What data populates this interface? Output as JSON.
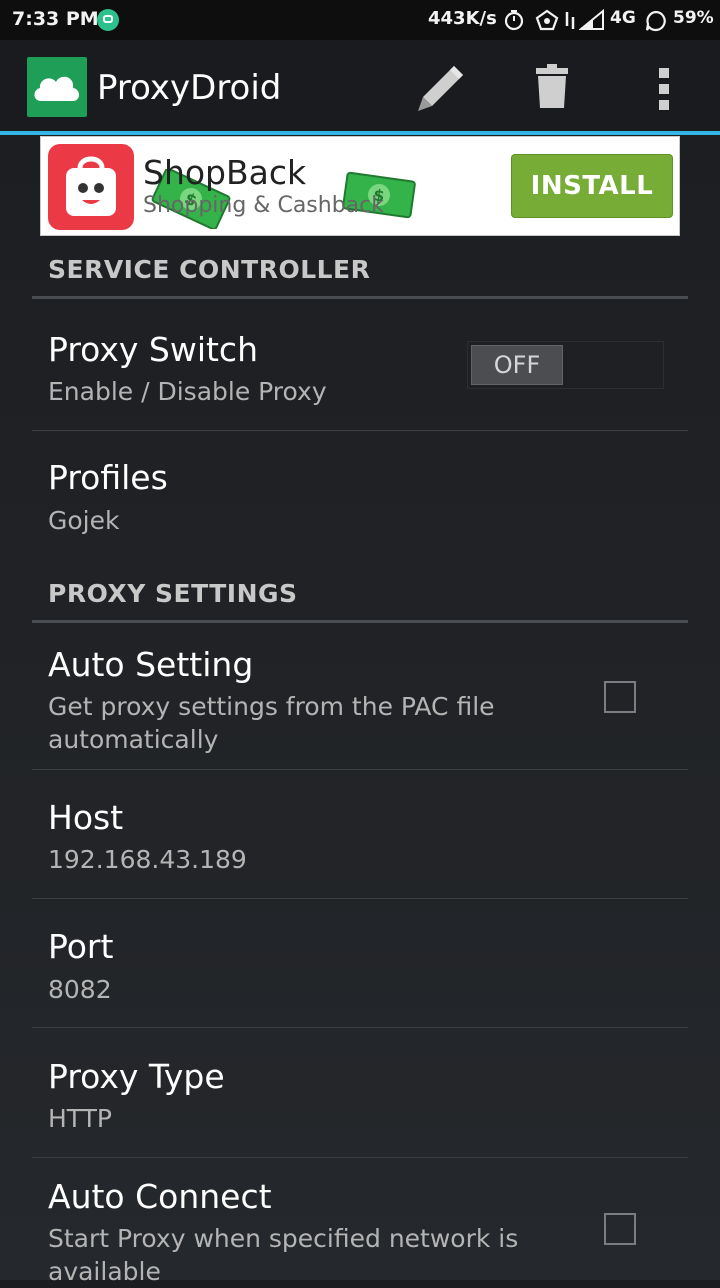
{
  "status_bar": {
    "time": "7:33 PM",
    "speed": "443K/s",
    "network": "4G",
    "battery": "59%",
    "icons": [
      "notification-icon",
      "timer-icon",
      "home-alert-icon",
      "signal-arrows-icon",
      "cell-signal-icon",
      "chat-icon"
    ]
  },
  "action_bar": {
    "title": "ProxyDroid",
    "actions": [
      "edit-icon",
      "delete-icon",
      "overflow-menu-icon"
    ],
    "accent_color": "#33b5e5"
  },
  "ad": {
    "title": "ShopBack",
    "subtitle": "Shopping & Cashback",
    "install_label": "INSTALL",
    "install_color": "#77ac36"
  },
  "sections": {
    "service_controller": "SERVICE CONTROLLER",
    "proxy_settings": "PROXY SETTINGS"
  },
  "prefs": {
    "proxy_switch": {
      "title": "Proxy Switch",
      "summary": "Enable / Disable Proxy",
      "toggle": "OFF"
    },
    "profiles": {
      "title": "Profiles",
      "summary": "Gojek"
    },
    "auto_setting": {
      "title": "Auto Setting",
      "summary": "Get proxy settings from the PAC file automatically",
      "checked": false
    },
    "host": {
      "title": "Host",
      "summary": "192.168.43.189"
    },
    "port": {
      "title": "Port",
      "summary": "8082"
    },
    "proxy_type": {
      "title": "Proxy Type",
      "summary": "HTTP"
    },
    "auto_connect": {
      "title": "Auto Connect",
      "summary": "Start Proxy when specified network is available",
      "checked": false
    }
  }
}
